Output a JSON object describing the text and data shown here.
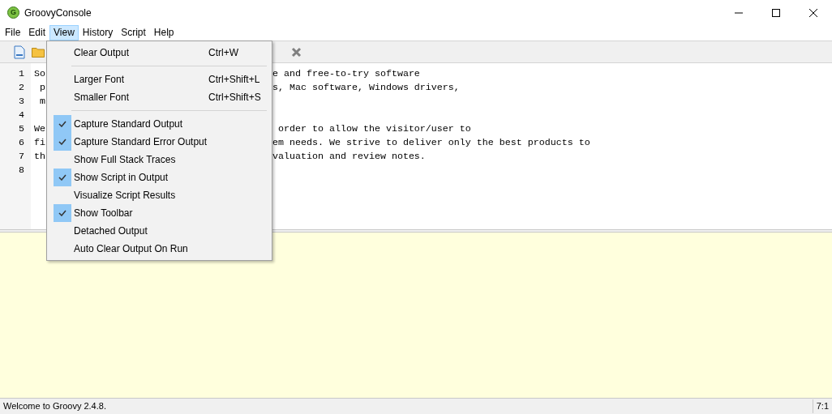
{
  "window": {
    "title": "GroovyConsole",
    "icon_letter": "G"
  },
  "menubar": [
    {
      "label": "File",
      "selected": false
    },
    {
      "label": "Edit",
      "selected": false
    },
    {
      "label": "View",
      "selected": true
    },
    {
      "label": "History",
      "selected": false
    },
    {
      "label": "Script",
      "selected": false
    },
    {
      "label": "Help",
      "selected": false
    }
  ],
  "view_menu": [
    {
      "kind": "item",
      "label": "Clear Output",
      "shortcut": "Ctrl+W"
    },
    {
      "kind": "separator"
    },
    {
      "kind": "item",
      "label": "Larger Font",
      "shortcut": "Ctrl+Shift+L"
    },
    {
      "kind": "item",
      "label": "Smaller Font",
      "shortcut": "Ctrl+Shift+S"
    },
    {
      "kind": "separator"
    },
    {
      "kind": "check",
      "label": "Capture Standard Output",
      "checked": true
    },
    {
      "kind": "check",
      "label": "Capture Standard Error Output",
      "checked": true
    },
    {
      "kind": "check",
      "label": "Show Full Stack Traces",
      "checked": false
    },
    {
      "kind": "check",
      "label": "Show Script in Output",
      "checked": true
    },
    {
      "kind": "check",
      "label": "Visualize Script Results",
      "checked": false
    },
    {
      "kind": "check",
      "label": "Show Toolbar",
      "checked": true
    },
    {
      "kind": "check",
      "label": "Detached Output",
      "checked": false
    },
    {
      "kind": "check",
      "label": "Auto Clear Output On Run",
      "checked": false
    }
  ],
  "editor": {
    "lines": [
      {
        "number": "1",
        "start": "So",
        "end": "e and free-to-try software"
      },
      {
        "number": "2",
        "start": " p",
        "end": "s, Mac software, Windows drivers,"
      },
      {
        "number": "3",
        "start": " m"
      },
      {
        "number": "4"
      },
      {
        "number": "5",
        "start": "We",
        "end": " order to allow the visitor/user to"
      },
      {
        "number": "6",
        "start": "fi",
        "end": "em needs. We strive to deliver only the best products to"
      },
      {
        "number": "7",
        "start": "th",
        "end": "valuation and review notes."
      },
      {
        "number": "8"
      }
    ]
  },
  "status_bar": {
    "message": "Welcome to Groovy 2.4.8.",
    "position": "7:1"
  }
}
